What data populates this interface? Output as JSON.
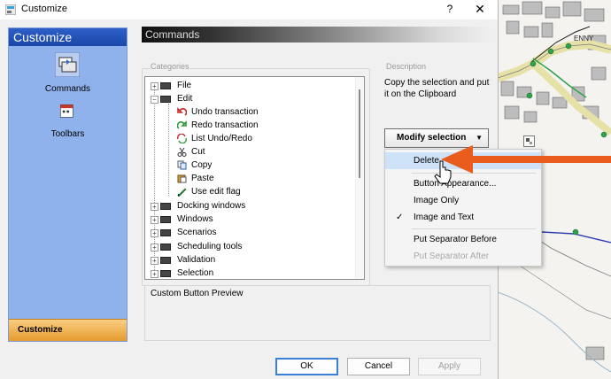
{
  "window": {
    "title": "Customize",
    "help": "?",
    "close": "✕"
  },
  "sidebar": {
    "header": "Customize",
    "items": [
      {
        "label": "Commands",
        "icon": "commands-icon"
      },
      {
        "label": "Toolbars",
        "icon": "toolbars-icon"
      }
    ],
    "footer": "Customize"
  },
  "commands_header": "Commands",
  "labels": {
    "categories": "Categories",
    "description": "Description"
  },
  "tree": {
    "items": [
      {
        "label": "File",
        "expander": "+",
        "level": 0
      },
      {
        "label": "Edit",
        "expander": "−",
        "level": 0
      },
      {
        "label": "Undo transaction",
        "icon": "undo-icon",
        "level": 1
      },
      {
        "label": "Redo transaction",
        "icon": "redo-icon",
        "level": 1
      },
      {
        "label": "List Undo/Redo",
        "icon": "list-undo-redo-icon",
        "level": 1
      },
      {
        "label": "Cut",
        "icon": "scissors-icon",
        "level": 1
      },
      {
        "label": "Copy",
        "icon": "copy-icon",
        "level": 1,
        "selected": true
      },
      {
        "label": "Paste",
        "icon": "paste-icon",
        "level": 1
      },
      {
        "label": "Use edit flag",
        "icon": "edit-flag-icon",
        "level": 1
      },
      {
        "label": "Docking windows",
        "expander": "+",
        "level": 0
      },
      {
        "label": "Windows",
        "expander": "+",
        "level": 0
      },
      {
        "label": "Scenarios",
        "expander": "+",
        "level": 0
      },
      {
        "label": "Scheduling tools",
        "expander": "+",
        "level": 0
      },
      {
        "label": "Validation",
        "expander": "+",
        "level": 0
      },
      {
        "label": "Selection",
        "expander": "+",
        "level": 0
      }
    ]
  },
  "description_text": "Copy the selection and put it on the Clipboard",
  "modify_button": {
    "label": "Modify selection",
    "arrow": "▼"
  },
  "context_menu": {
    "items": [
      {
        "label": "Delete",
        "highlighted": true
      },
      {
        "label": "Button Appearance..."
      },
      {
        "label": "Image Only"
      },
      {
        "label": "Image and Text",
        "checked": true,
        "check": "✓"
      },
      {
        "label": "Put Separator Before"
      },
      {
        "label": "Put Separator After",
        "disabled": true
      }
    ]
  },
  "preview_label": "Custom Button Preview",
  "buttons": {
    "ok": "OK",
    "cancel": "Cancel",
    "apply": "Apply"
  },
  "map_labels": {
    "road_label": "ENNY"
  },
  "colors": {
    "sidebar_header": "#2c5fc7",
    "sidebar_bg": "#8fb2ec",
    "footer": "#e79b2e",
    "menu_highlight": "#cde1f7",
    "annotation_arrow": "#ea5b1e"
  }
}
